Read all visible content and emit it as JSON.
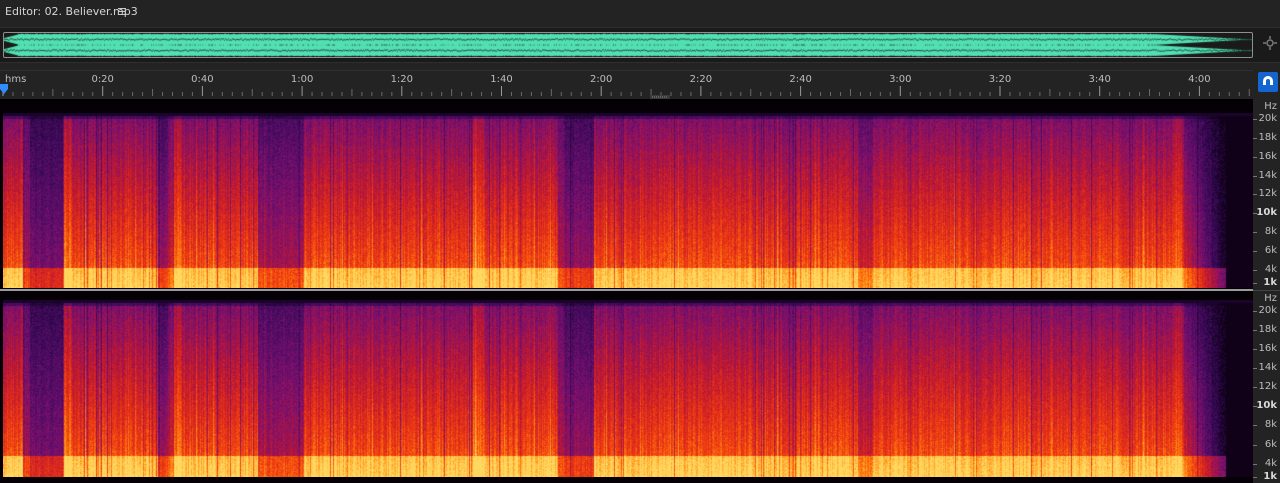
{
  "editor": {
    "title": "Editor: 02. Believer.mp3",
    "menu_icon": "hamburger-menu-icon"
  },
  "overview": {
    "wave_color": "#52e0b2",
    "zoom_icon": "zoom-navigator-icon"
  },
  "timeline": {
    "unit": "hms",
    "ticks": [
      {
        "label": "0:20",
        "seconds": 20
      },
      {
        "label": "0:40",
        "seconds": 40
      },
      {
        "label": "1:00",
        "seconds": 60
      },
      {
        "label": "1:20",
        "seconds": 80
      },
      {
        "label": "1:40",
        "seconds": 100
      },
      {
        "label": "2:00",
        "seconds": 120
      },
      {
        "label": "2:20",
        "seconds": 140
      },
      {
        "label": "2:40",
        "seconds": 160
      },
      {
        "label": "3:00",
        "seconds": 180
      },
      {
        "label": "3:20",
        "seconds": 200
      },
      {
        "label": "3:40",
        "seconds": 220
      },
      {
        "label": "4:00",
        "seconds": 240
      }
    ],
    "playhead_color": "#2f8dff",
    "snap_icon": "magnet-icon",
    "snap_color": "#1565d0"
  },
  "frequency_axis": {
    "unit": "Hz",
    "labels": [
      {
        "text": "20k",
        "major": false
      },
      {
        "text": "18k",
        "major": false
      },
      {
        "text": "16k",
        "major": false
      },
      {
        "text": "14k",
        "major": false
      },
      {
        "text": "12k",
        "major": false
      },
      {
        "text": "10k",
        "major": true
      },
      {
        "text": "8k",
        "major": false
      },
      {
        "text": "6k",
        "major": false
      },
      {
        "text": "4k",
        "major": false
      },
      {
        "text": "1k",
        "major": true
      }
    ]
  },
  "spectrogram": {
    "palette": [
      "#0a0010",
      "#3a0a5a",
      "#7a1070",
      "#c01830",
      "#f03a10",
      "#ff8a10",
      "#ffd860"
    ]
  }
}
